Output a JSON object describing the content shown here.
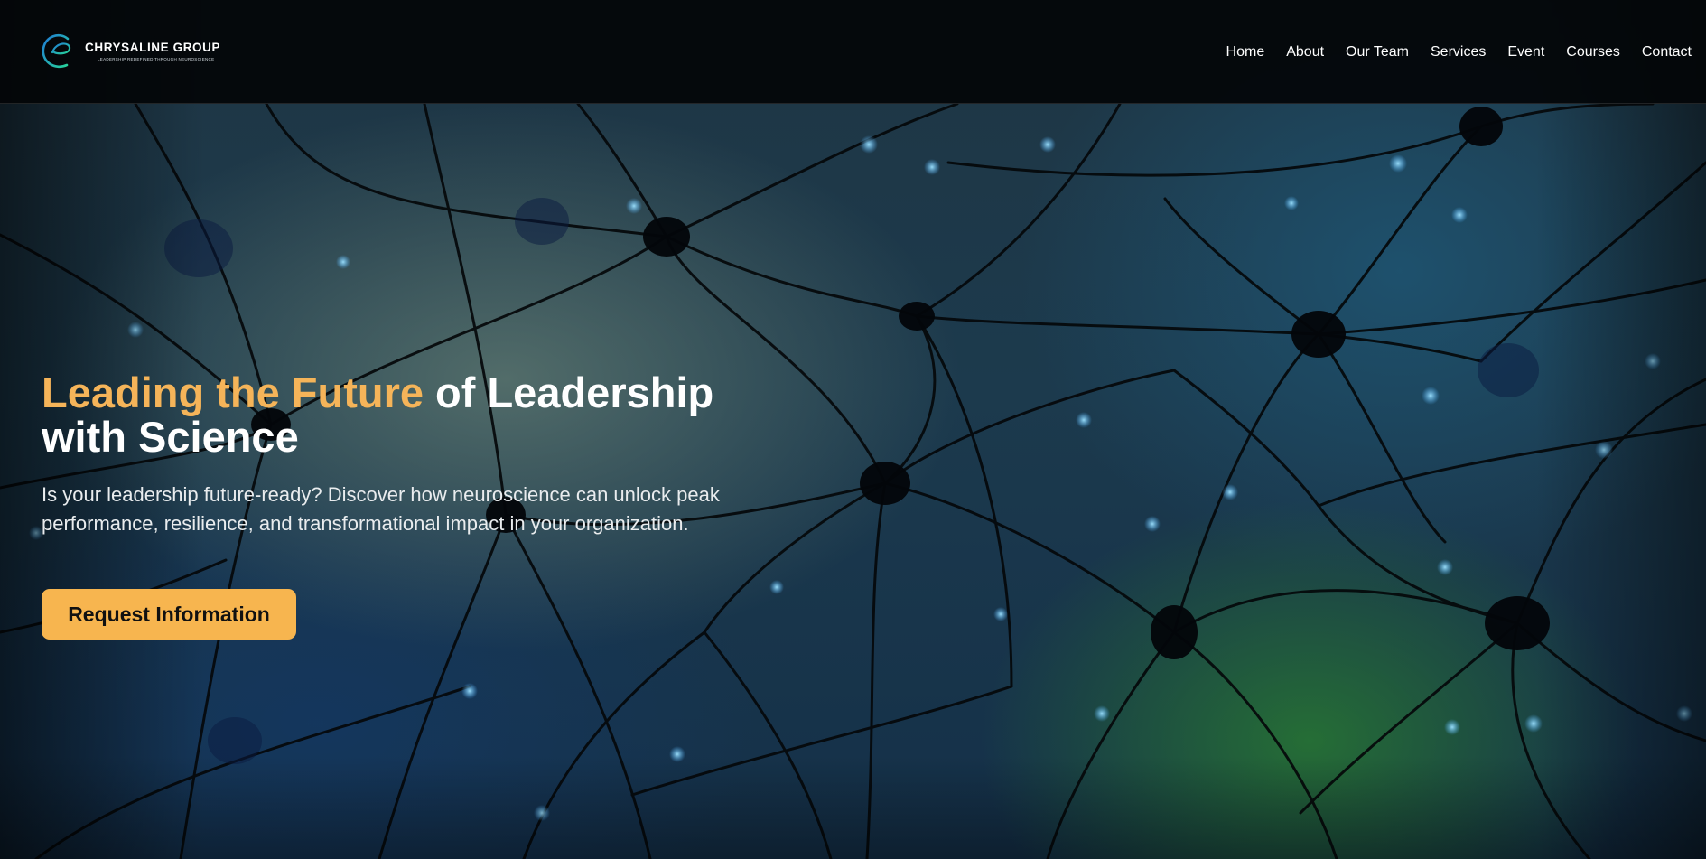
{
  "brand": {
    "name": "CHRYSALINE GROUP",
    "tagline": "LEADERSHIP REDEFINED THROUGH NEUROSCIENCE",
    "icon": "chrysaline-c-logo-icon"
  },
  "nav": {
    "items": [
      {
        "label": "Home"
      },
      {
        "label": "About"
      },
      {
        "label": "Our Team"
      },
      {
        "label": "Services"
      },
      {
        "label": "Event"
      },
      {
        "label": "Courses"
      },
      {
        "label": "Contact"
      }
    ]
  },
  "hero": {
    "headline_accent": "Leading the Future",
    "headline_rest": " of Leadership with Science",
    "subtext": "Is your leadership future-ready? Discover how neuroscience can unlock peak performance, resilience, and transformational impact in your organization.",
    "cta_label": "Request Information",
    "background": "neuron-network-image"
  },
  "colors": {
    "accent": "#f5b459",
    "button": "#f7b54f",
    "header_bg": "#030508",
    "text": "#ffffff"
  }
}
